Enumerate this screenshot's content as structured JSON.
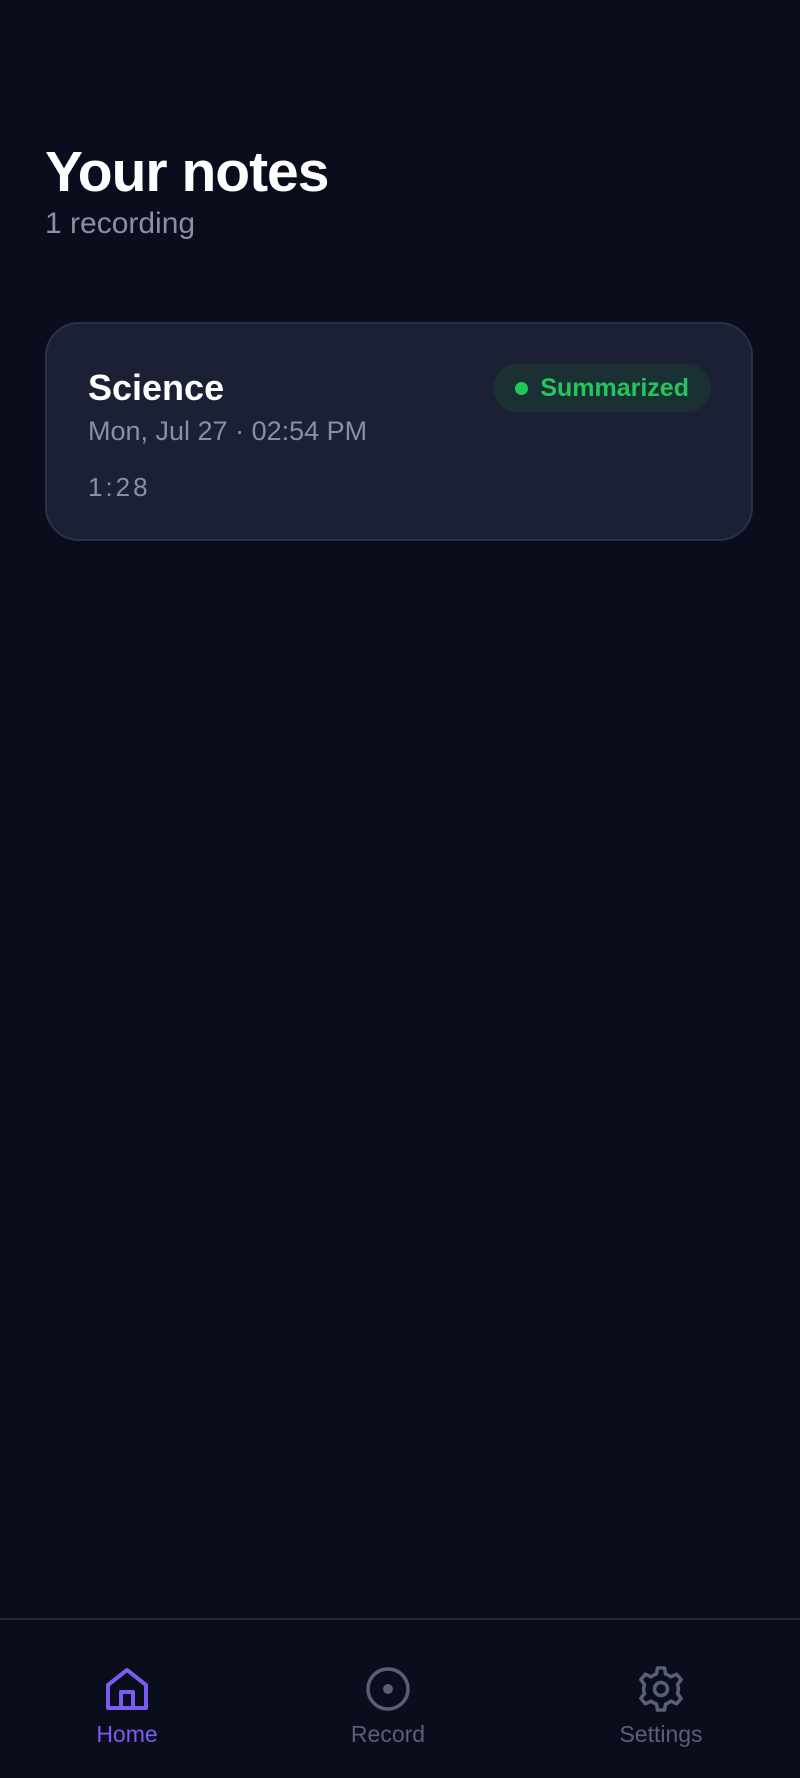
{
  "header": {
    "title": "Your notes",
    "subtitle": "1 recording"
  },
  "notes": [
    {
      "title": "Science",
      "date": "Mon, Jul 27 · 02:54 PM",
      "duration": "1:28",
      "status": "Summarized",
      "status_color": "#22c55e"
    }
  ],
  "nav": {
    "items": [
      {
        "label": "Home",
        "icon": "home-icon",
        "active": true
      },
      {
        "label": "Record",
        "icon": "record-icon",
        "active": false
      },
      {
        "label": "Settings",
        "icon": "gear-icon",
        "active": false
      }
    ],
    "active_color": "#7c5cf0",
    "inactive_color": "#5a5f78"
  },
  "colors": {
    "background": "#0a0d1c",
    "card": "#1c2035",
    "text_primary": "#ffffff",
    "text_secondary": "#8b8fa3"
  }
}
